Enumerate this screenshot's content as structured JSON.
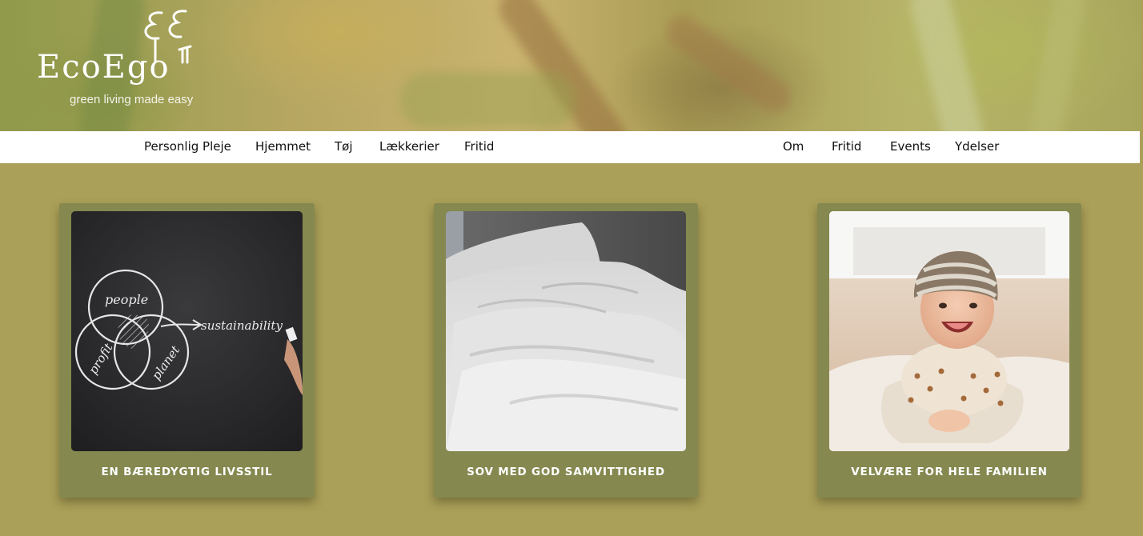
{
  "brand": {
    "name": "EcoEgo",
    "tagline": "green living made easy"
  },
  "nav": {
    "left": [
      "Personlig Pleje",
      "Hjemmet",
      "Tøj",
      "Lækkerier",
      "Fritid"
    ],
    "right": [
      "Om",
      "Fritid",
      "Events",
      "Ydelser"
    ]
  },
  "cards": [
    {
      "title": "EN BÆREDYGTIG LIVSSTIL",
      "image": "chalkboard-sustainability-diagram",
      "chalk_words": [
        "people",
        "sustainability",
        "profit",
        "planet"
      ]
    },
    {
      "title": "SOV MED GOD SAMVITTIGHED",
      "image": "white-bed-linen"
    },
    {
      "title": "VELVÆRE FOR HELE FAMILIEN",
      "image": "smiling-baby-on-rug"
    }
  ],
  "colors": {
    "background": "#aba059",
    "card": "#85884f",
    "navbar": "#ffffff",
    "card_title": "#ffffff"
  }
}
